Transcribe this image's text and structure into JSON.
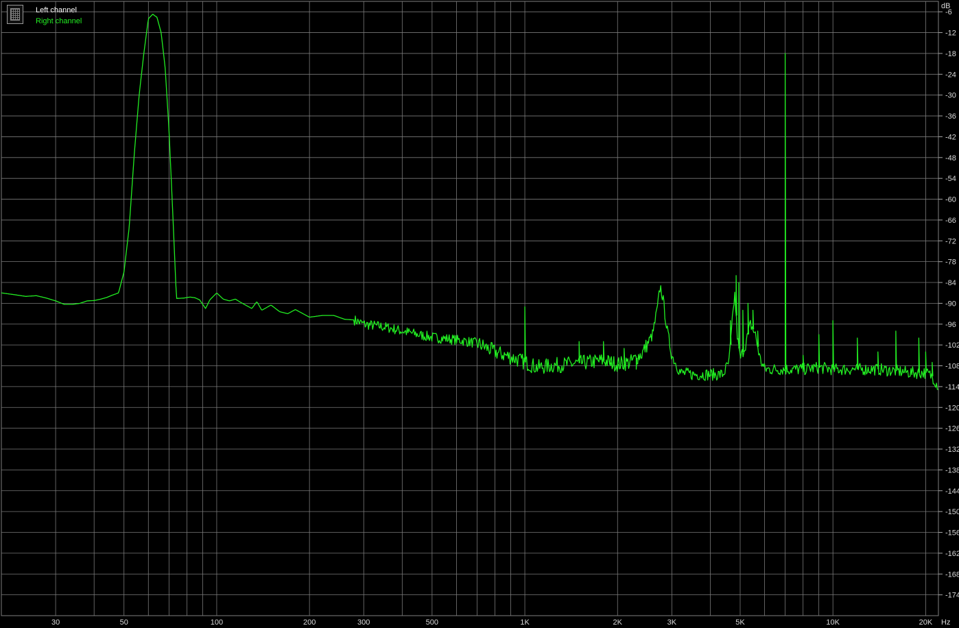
{
  "chart_data": {
    "type": "line",
    "title": "",
    "xlabel": "",
    "ylabel": "",
    "x_unit": "Hz",
    "y_unit": "dB",
    "x_scale": "log",
    "xlim": [
      20,
      22000
    ],
    "ylim": [
      -180,
      -3
    ],
    "x_ticks": [
      {
        "value": 30,
        "label": "30"
      },
      {
        "value": 50,
        "label": "50"
      },
      {
        "value": 100,
        "label": "100"
      },
      {
        "value": 200,
        "label": "200"
      },
      {
        "value": 300,
        "label": "300"
      },
      {
        "value": 500,
        "label": "500"
      },
      {
        "value": 1000,
        "label": "1K"
      },
      {
        "value": 2000,
        "label": "2K"
      },
      {
        "value": 3000,
        "label": "3K"
      },
      {
        "value": 5000,
        "label": "5K"
      },
      {
        "value": 10000,
        "label": "10K"
      },
      {
        "value": 20000,
        "label": "20K"
      }
    ],
    "y_ticks": [
      -6,
      -12,
      -18,
      -24,
      -30,
      -36,
      -42,
      -48,
      -54,
      -60,
      -66,
      -72,
      -78,
      -84,
      -90,
      -96,
      -102,
      -108,
      -114,
      -120,
      -126,
      -132,
      -138,
      -144,
      -150,
      -156,
      -162,
      -168,
      -174
    ],
    "grid": true,
    "legend_position": "top-left",
    "series": [
      {
        "name": "Left channel",
        "color": "#ffffff",
        "role": "hidden-behind-right"
      },
      {
        "name": "Right channel",
        "color": "#22ee22",
        "points": [
          [
            20,
            -87
          ],
          [
            22,
            -87.5
          ],
          [
            24,
            -88
          ],
          [
            26,
            -87.8
          ],
          [
            28,
            -88.5
          ],
          [
            30,
            -89.3
          ],
          [
            32,
            -90.3
          ],
          [
            34,
            -90.3
          ],
          [
            36,
            -90
          ],
          [
            38,
            -89.3
          ],
          [
            40,
            -89.2
          ],
          [
            42,
            -88.8
          ],
          [
            44,
            -88.3
          ],
          [
            46,
            -87.6
          ],
          [
            48,
            -87
          ],
          [
            50,
            -81
          ],
          [
            52,
            -68
          ],
          [
            54,
            -47
          ],
          [
            56,
            -30
          ],
          [
            58,
            -18
          ],
          [
            60,
            -8
          ],
          [
            62,
            -6.7
          ],
          [
            64,
            -7.6
          ],
          [
            66,
            -12
          ],
          [
            68,
            -22
          ],
          [
            70,
            -40
          ],
          [
            72,
            -64
          ],
          [
            74,
            -88.6
          ],
          [
            78,
            -88.5
          ],
          [
            82,
            -88.2
          ],
          [
            85,
            -88.4
          ],
          [
            88,
            -89
          ],
          [
            92,
            -91.5
          ],
          [
            95,
            -89
          ],
          [
            100,
            -87
          ],
          [
            105,
            -88.8
          ],
          [
            110,
            -89.3
          ],
          [
            115,
            -88.8
          ],
          [
            120,
            -89.8
          ],
          [
            130,
            -91.5
          ],
          [
            135,
            -89.5
          ],
          [
            140,
            -92
          ],
          [
            150,
            -90.5
          ],
          [
            160,
            -92.4
          ],
          [
            170,
            -93
          ],
          [
            180,
            -91.8
          ],
          [
            200,
            -94
          ],
          [
            220,
            -93.5
          ],
          [
            240,
            -93.5
          ],
          [
            260,
            -94.6
          ],
          [
            280,
            -94.8
          ],
          [
            300,
            -96
          ],
          [
            330,
            -96.5
          ],
          [
            360,
            -97
          ],
          [
            400,
            -98
          ],
          [
            450,
            -99
          ],
          [
            500,
            -99.8
          ],
          [
            560,
            -100.2
          ],
          [
            630,
            -100.8
          ],
          [
            700,
            -101.5
          ],
          [
            800,
            -104
          ],
          [
            900,
            -105.5
          ],
          [
            1000,
            -107
          ],
          [
            1100,
            -108.5
          ],
          [
            1200,
            -108
          ],
          [
            1400,
            -107.5
          ],
          [
            1600,
            -107
          ],
          [
            1800,
            -106.5
          ],
          [
            2000,
            -107.5
          ],
          [
            2200,
            -107
          ],
          [
            2400,
            -104.5
          ],
          [
            2600,
            -99
          ],
          [
            2700,
            -91
          ],
          [
            2750,
            -85
          ],
          [
            2800,
            -88
          ],
          [
            2900,
            -98
          ],
          [
            3000,
            -105
          ],
          [
            3200,
            -110
          ],
          [
            3500,
            -110.5
          ],
          [
            4000,
            -110.5
          ],
          [
            4400,
            -110.5
          ],
          [
            4600,
            -107
          ],
          [
            4800,
            -87
          ],
          [
            4900,
            -100
          ],
          [
            5000,
            -106
          ],
          [
            5200,
            -102
          ],
          [
            5400,
            -96
          ],
          [
            5600,
            -99
          ],
          [
            5800,
            -106
          ],
          [
            6000,
            -109
          ],
          [
            7000,
            -109
          ],
          [
            8000,
            -109
          ],
          [
            9000,
            -108.5
          ],
          [
            10000,
            -109
          ],
          [
            12000,
            -109
          ],
          [
            14000,
            -109
          ],
          [
            16000,
            -109.5
          ],
          [
            18000,
            -110
          ],
          [
            20000,
            -110
          ],
          [
            21000,
            -111
          ],
          [
            22000,
            -114
          ]
        ],
        "spikes": [
          [
            1000,
            -91
          ],
          [
            1200,
            -108
          ],
          [
            1500,
            -101
          ],
          [
            1800,
            -101
          ],
          [
            1900,
            -108
          ],
          [
            2000,
            -109
          ],
          [
            2100,
            -103
          ],
          [
            2300,
            -109
          ],
          [
            3500,
            -110
          ],
          [
            4000,
            -111
          ],
          [
            4650,
            -95
          ],
          [
            4850,
            -82
          ],
          [
            4950,
            -84
          ],
          [
            5100,
            -92
          ],
          [
            5300,
            -90
          ],
          [
            5500,
            -92
          ],
          [
            5700,
            -98
          ],
          [
            7000,
            -18
          ],
          [
            8000,
            -105
          ],
          [
            9000,
            -99
          ],
          [
            10000,
            -95
          ],
          [
            12000,
            -100
          ],
          [
            14000,
            -104
          ],
          [
            16000,
            -98
          ],
          [
            19000,
            -100
          ],
          [
            20000,
            -104
          ],
          [
            21000,
            -107
          ]
        ]
      }
    ]
  }
}
